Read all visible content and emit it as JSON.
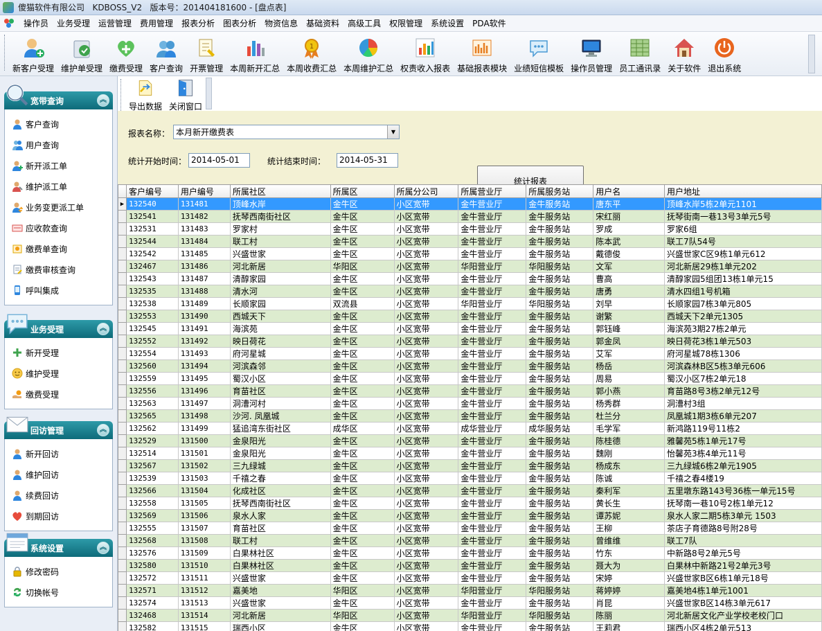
{
  "window": {
    "title": "傻猫软件有限公司   KDBOSS_V2   版本号：201404181600 - [盘点表]"
  },
  "menu": [
    "操作员",
    "业务受理",
    "运营管理",
    "费用管理",
    "报表分析",
    "图表分析",
    "物资信息",
    "基础资料",
    "高级工具",
    "权限管理",
    "系统设置",
    "PDA软件"
  ],
  "toolbar": [
    {
      "label": "新客户受理",
      "icon": "add-customer-icon"
    },
    {
      "label": "维护单受理",
      "icon": "maintenance-order-icon"
    },
    {
      "label": "缴费受理",
      "icon": "payment-icon"
    },
    {
      "label": "客户查询",
      "icon": "customer-search-icon"
    },
    {
      "label": "开票管理",
      "icon": "invoice-icon"
    },
    {
      "label": "本周新开汇总",
      "icon": "bar-chart-icon"
    },
    {
      "label": "本周收费汇总",
      "icon": "award-icon"
    },
    {
      "label": "本周维护汇总",
      "icon": "pie-chart-icon"
    },
    {
      "label": "权责收入报表",
      "icon": "report-chart-icon"
    },
    {
      "label": "基础报表模块",
      "icon": "report-module-icon"
    },
    {
      "label": "业绩短信模板",
      "icon": "sms-icon"
    },
    {
      "label": "操作员管理",
      "icon": "operator-icon"
    },
    {
      "label": "员工通讯录",
      "icon": "address-book-icon"
    },
    {
      "label": "关于软件",
      "icon": "home-icon"
    },
    {
      "label": "退出系统",
      "icon": "power-icon"
    }
  ],
  "sidebar": {
    "panels": [
      {
        "title": "宽带查询",
        "icon": "search-magnifier-icon",
        "items": [
          {
            "label": "客户查询",
            "icon": "user-icon"
          },
          {
            "label": "用户查询",
            "icon": "users-icon"
          },
          {
            "label": "新开派工单",
            "icon": "user-add-icon"
          },
          {
            "label": "维护派工单",
            "icon": "user-wrench-icon"
          },
          {
            "label": "业务变更派工单",
            "icon": "user-change-icon"
          },
          {
            "label": "应收款查询",
            "icon": "receivable-icon"
          },
          {
            "label": "缴费单查询",
            "icon": "payment-slip-icon"
          },
          {
            "label": "缴费审核查询",
            "icon": "audit-icon"
          },
          {
            "label": "呼叫集成",
            "icon": "phone-icon"
          }
        ]
      },
      {
        "title": "业务受理",
        "icon": "chat-bubble-icon",
        "items": [
          {
            "label": "新开受理",
            "icon": "plus-icon"
          },
          {
            "label": "维护受理",
            "icon": "smiley-icon"
          },
          {
            "label": "缴费受理",
            "icon": "hand-money-icon"
          }
        ]
      },
      {
        "title": "回访管理",
        "icon": "envelope-icon",
        "items": [
          {
            "label": "新开回访",
            "icon": "user-icon"
          },
          {
            "label": "维护回访",
            "icon": "user-icon"
          },
          {
            "label": "续费回访",
            "icon": "user-icon"
          },
          {
            "label": "到期回访",
            "icon": "heart-icon"
          }
        ]
      },
      {
        "title": "系统设置",
        "icon": "window-icon",
        "items": [
          {
            "label": "修改密码",
            "icon": "lock-icon"
          },
          {
            "label": "切换帐号",
            "icon": "switch-icon"
          }
        ]
      }
    ]
  },
  "subtoolbar": [
    {
      "label": "导出数据",
      "icon": "export-icon"
    },
    {
      "label": "关闭窗口",
      "icon": "close-window-icon"
    }
  ],
  "filter": {
    "report_label": "报表名称：",
    "report_value": "本月新开缴费表",
    "start_label": "统计开始时间：",
    "start_value": "2014-05-01",
    "end_label": "统计结束时间：",
    "end_value": "2014-05-31",
    "stat_button": "统计报表"
  },
  "grid": {
    "columns": [
      "客户编号",
      "用户编号",
      "所属社区",
      "所属区",
      "所属分公司",
      "所属营业厅",
      "所属服务站",
      "用户名",
      "用户地址"
    ],
    "rows": [
      [
        "132540",
        "131481",
        "顶峰水岸",
        "金牛区",
        "小区宽带",
        "金牛营业厅",
        "金牛服务站",
        "唐东平",
        "顶峰水岸5栋2单元1101"
      ],
      [
        "132541",
        "131482",
        "抚琴西南街社区",
        "金牛区",
        "小区宽带",
        "金牛营业厅",
        "金牛服务站",
        "宋红丽",
        "抚琴街南一巷13号3单元5号"
      ],
      [
        "132531",
        "131483",
        "罗家村",
        "金牛区",
        "小区宽带",
        "金牛营业厅",
        "金牛服务站",
        "罗成",
        "罗家6组"
      ],
      [
        "132544",
        "131484",
        "联工村",
        "金牛区",
        "小区宽带",
        "金牛营业厅",
        "金牛服务站",
        "陈本武",
        "联工7队54号"
      ],
      [
        "132542",
        "131485",
        "兴盛世家",
        "金牛区",
        "小区宽带",
        "金牛营业厅",
        "金牛服务站",
        "戴德俊",
        "兴盛世家C区9栋1单元612"
      ],
      [
        "132467",
        "131486",
        "河北新居",
        "华阳区",
        "小区宽带",
        "华阳营业厅",
        "华阳服务站",
        "文军",
        "河北新居29栋1单元202"
      ],
      [
        "132543",
        "131487",
        "清醇家园",
        "金牛区",
        "小区宽带",
        "金牛营业厅",
        "金牛服务站",
        "曹高",
        "清醇家园5组团13栋1单元15"
      ],
      [
        "132535",
        "131488",
        "清水河",
        "金牛区",
        "小区宽带",
        "金牛营业厅",
        "金牛服务站",
        "唐勇",
        "清水四组1号机箱"
      ],
      [
        "132538",
        "131489",
        "长顺家园",
        "双流县",
        "小区宽带",
        "华阳营业厅",
        "华阳服务站",
        "刘早",
        "长顺家园7栋3单元805"
      ],
      [
        "132553",
        "131490",
        "西城天下",
        "金牛区",
        "小区宽带",
        "金牛营业厅",
        "金牛服务站",
        "谢繁",
        "西城天下2单元1305"
      ],
      [
        "132545",
        "131491",
        "海滨苑",
        "金牛区",
        "小区宽带",
        "金牛营业厅",
        "金牛服务站",
        "郭钰峰",
        "海滨苑3期27栋2单元"
      ],
      [
        "132552",
        "131492",
        "映日荷花",
        "金牛区",
        "小区宽带",
        "金牛营业厅",
        "金牛服务站",
        "郭金凤",
        "映日荷花3栋1单元503"
      ],
      [
        "132554",
        "131493",
        "府河星城",
        "金牛区",
        "小区宽带",
        "金牛营业厅",
        "金牛服务站",
        "艾军",
        "府河星城78栋1306"
      ],
      [
        "132560",
        "131494",
        "河滨森邻",
        "金牛区",
        "小区宽带",
        "金牛营业厅",
        "金牛服务站",
        "杨岳",
        "河滨森林B区5栋3单元606"
      ],
      [
        "132559",
        "131495",
        "蜀汉小区",
        "金牛区",
        "小区宽带",
        "金牛营业厅",
        "金牛服务站",
        "周易",
        "蜀汉小区7栋2单元18"
      ],
      [
        "132556",
        "131496",
        "育苗社区",
        "金牛区",
        "小区宽带",
        "金牛营业厅",
        "金牛服务站",
        "郭小燕",
        "育苗路8号3栋2单元12号"
      ],
      [
        "132563",
        "131497",
        "洞漕河村",
        "金牛区",
        "小区宽带",
        "金牛营业厅",
        "金牛服务站",
        "杨秀群",
        "洞漕村3组"
      ],
      [
        "132565",
        "131498",
        "沙河. 凤凰城",
        "金牛区",
        "小区宽带",
        "金牛营业厅",
        "金牛服务站",
        "杜兰分",
        "凤凰城1期3栋6单元207"
      ],
      [
        "132562",
        "131499",
        "猛追湾东街社区",
        "成华区",
        "小区宽带",
        "成华营业厅",
        "成华服务站",
        "毛学军",
        "新鸿路119号11栋2"
      ],
      [
        "132529",
        "131500",
        "金泉阳光",
        "金牛区",
        "小区宽带",
        "金牛营业厅",
        "金牛服务站",
        "陈桂德",
        "雅馨苑5栋1单元17号"
      ],
      [
        "132514",
        "131501",
        "金泉阳光",
        "金牛区",
        "小区宽带",
        "金牛营业厅",
        "金牛服务站",
        "魏刚",
        "怡馨苑3栋4单元11号"
      ],
      [
        "132567",
        "131502",
        "三九绿城",
        "金牛区",
        "小区宽带",
        "金牛营业厅",
        "金牛服务站",
        "杨成东",
        "三九绿城6栋2单元1905"
      ],
      [
        "132539",
        "131503",
        "千禧之春",
        "金牛区",
        "小区宽带",
        "金牛营业厅",
        "金牛服务站",
        "陈诚",
        "千禧之春4楼19"
      ],
      [
        "132566",
        "131504",
        "化成社区",
        "金牛区",
        "小区宽带",
        "金牛营业厅",
        "金牛服务站",
        "秦利军",
        "五里墩东路143号36栋一单元15号"
      ],
      [
        "132558",
        "131505",
        "抚琴西南街社区",
        "金牛区",
        "小区宽带",
        "金牛营业厅",
        "金牛服务站",
        "黄长生",
        "抚琴南一巷10号2栋1单元12"
      ],
      [
        "132569",
        "131506",
        "泉水人家",
        "金牛区",
        "小区宽带",
        "金牛营业厅",
        "金牛服务站",
        "谭苏妮",
        "泉水人家二期5栋3单元 1503"
      ],
      [
        "132555",
        "131507",
        "育苗社区",
        "金牛区",
        "小区宽带",
        "金牛营业厅",
        "金牛服务站",
        "王柳",
        "茶店子育德路8号附28号"
      ],
      [
        "132568",
        "131508",
        "联工村",
        "金牛区",
        "小区宽带",
        "金牛营业厅",
        "金牛服务站",
        "曾维维",
        "联工7队"
      ],
      [
        "132576",
        "131509",
        "白果林社区",
        "金牛区",
        "小区宽带",
        "金牛营业厅",
        "金牛服务站",
        "竹东",
        "中新路8号2单元5号"
      ],
      [
        "132580",
        "131510",
        "白果林社区",
        "金牛区",
        "小区宽带",
        "金牛营业厅",
        "金牛服务站",
        "聂大为",
        "白果林中新路21号2单元3号"
      ],
      [
        "132572",
        "131511",
        "兴盛世家",
        "金牛区",
        "小区宽带",
        "金牛营业厅",
        "金牛服务站",
        "宋婷",
        "兴盛世家B区6栋1单元18号"
      ],
      [
        "132571",
        "131512",
        "嘉美地",
        "华阳区",
        "小区宽带",
        "华阳营业厅",
        "华阳服务站",
        "蒋婷婷",
        "嘉美地4栋1单元1001"
      ],
      [
        "132574",
        "131513",
        "兴盛世家",
        "金牛区",
        "小区宽带",
        "金牛营业厅",
        "金牛服务站",
        "肖昆",
        "兴盛世家B区14栋3单元617"
      ],
      [
        "132468",
        "131514",
        "河北新居",
        "华阳区",
        "小区宽带",
        "华阳营业厅",
        "华阳服务站",
        "陈丽",
        "河北新居文化产业学校老校门口"
      ],
      [
        "132582",
        "131515",
        "瑞西小区",
        "金牛区",
        "小区宽带",
        "金牛营业厅",
        "金牛服务站",
        "王莉君",
        "瑞西小区4栋2单元513"
      ]
    ],
    "selected_row": 0,
    "row_indicator": "▶"
  }
}
